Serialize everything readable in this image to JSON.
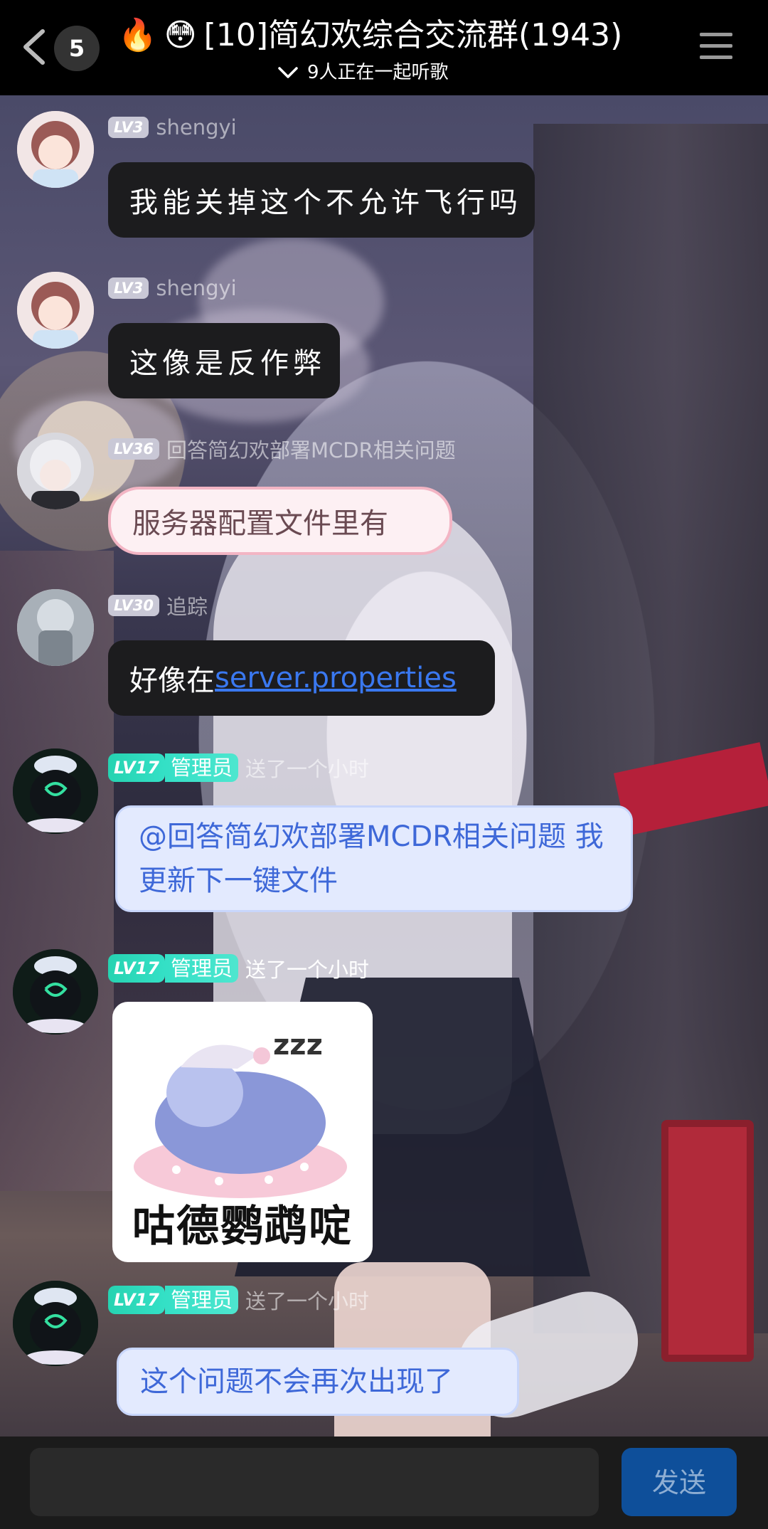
{
  "header": {
    "back_count": "5",
    "title_emoji_1": "🔥",
    "title_emoji_2": "😳",
    "title": "[10]简幻欢综合交流群(1943)",
    "subtitle": "9人正在一起听歌"
  },
  "messages": [
    {
      "level": "LV3",
      "nickname": "shengyi",
      "text": "我能关掉这个不允许飞行吗"
    },
    {
      "level": "LV3",
      "nickname": "shengyi",
      "text": "这像是反作弊"
    },
    {
      "level": "LV36",
      "nickname": "回答简幻欢部署MCDR相关问题",
      "text": "服务器配置文件里有"
    },
    {
      "level": "LV30",
      "nickname": "追踪",
      "text_prefix": "好像在",
      "link": "server.properties"
    },
    {
      "level": "LV17",
      "role": "管理员",
      "nickname": "送了一个小时",
      "text": "@回答简幻欢部署MCDR相关问题 我更新下一键文件"
    },
    {
      "level": "LV17",
      "role": "管理员",
      "nickname": "送了一个小时",
      "sticker_caption": "咕德鹦鹉啶"
    },
    {
      "level": "LV17",
      "role": "管理员",
      "nickname": "送了一个小时",
      "text": "这个问题不会再次出现了"
    }
  ],
  "input": {
    "placeholder": "",
    "send_label": "发送"
  },
  "colors": {
    "admin_tag": "#34e0c6",
    "send_button": "#0e4f9a",
    "link": "#3a78f0"
  }
}
